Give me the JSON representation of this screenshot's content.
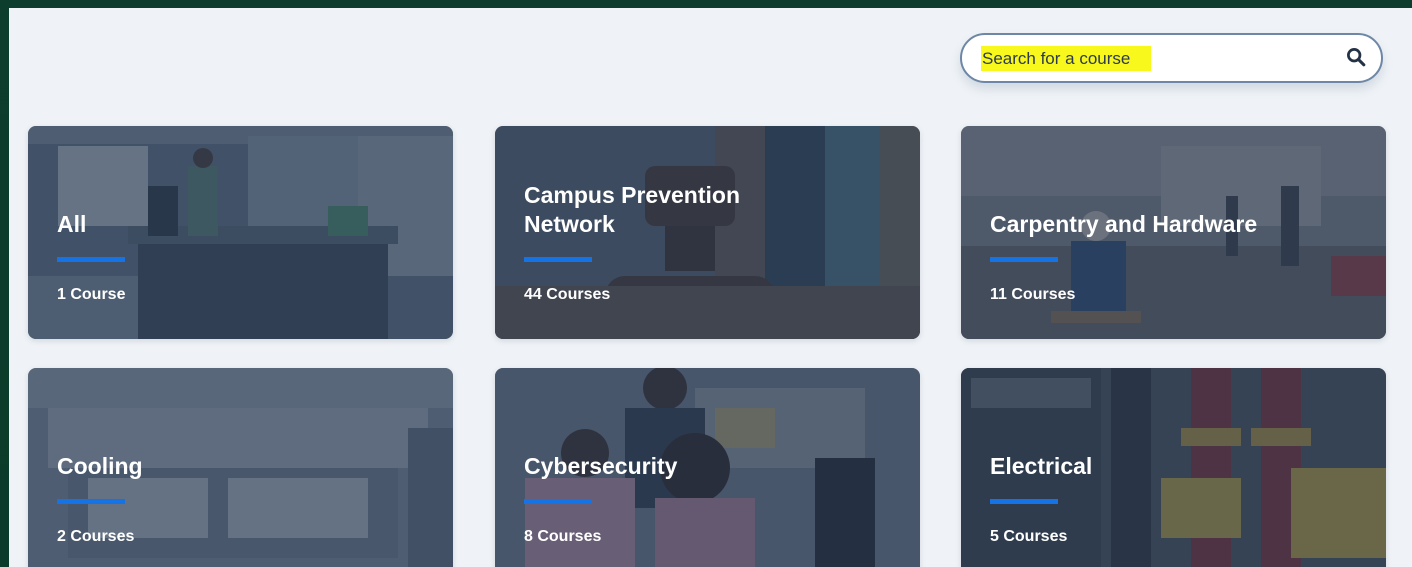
{
  "search": {
    "placeholder": "Search for a course",
    "highlight_color": "#f8f81c"
  },
  "colors": {
    "page_background": "#eff3f7",
    "frame_background": "#0b3b2a",
    "accent_bar": "#1573e6",
    "search_border": "#6e87a6"
  },
  "categories": [
    {
      "title": "All",
      "count": "1 Course"
    },
    {
      "title": "Campus Prevention Network",
      "count": "44 Courses"
    },
    {
      "title": "Carpentry and Hardware",
      "count": "11 Courses"
    },
    {
      "title": "Cooling",
      "count": "2 Courses"
    },
    {
      "title": "Cybersecurity",
      "count": "8 Courses"
    },
    {
      "title": "Electrical",
      "count": "5 Courses"
    }
  ]
}
